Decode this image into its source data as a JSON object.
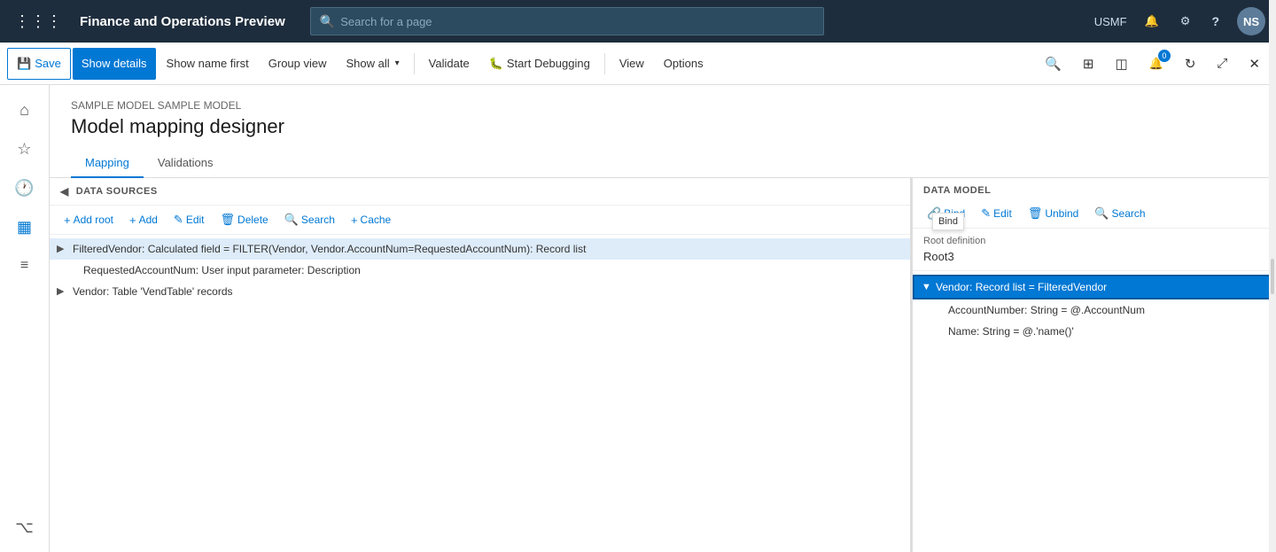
{
  "app": {
    "title": "Finance and Operations Preview",
    "env": "USMF"
  },
  "searchbar": {
    "placeholder": "Search for a page"
  },
  "toolbar": {
    "save": "Save",
    "show_details": "Show details",
    "show_name_first": "Show name first",
    "group_view": "Group view",
    "show_all": "Show all",
    "validate": "Validate",
    "start_debugging": "Start Debugging",
    "view": "View",
    "options": "Options"
  },
  "breadcrumb": "SAMPLE MODEL SAMPLE MODEL",
  "page_title": "Model mapping designer",
  "tabs": [
    {
      "label": "Mapping",
      "active": true
    },
    {
      "label": "Validations",
      "active": false
    }
  ],
  "datasources_panel": {
    "header": "DATA SOURCES",
    "buttons": [
      {
        "icon": "+",
        "label": "Add root"
      },
      {
        "icon": "+",
        "label": "Add"
      },
      {
        "icon": "✎",
        "label": "Edit"
      },
      {
        "icon": "🗑",
        "label": "Delete"
      },
      {
        "icon": "🔍",
        "label": "Search"
      },
      {
        "icon": "+",
        "label": "Cache"
      }
    ],
    "items": [
      {
        "indent": 0,
        "toggle": "▶",
        "text": "FilteredVendor: Calculated field = FILTER(Vendor, Vendor.AccountNum=RequestedAccountNum): Record list",
        "selected": true
      },
      {
        "indent": 1,
        "toggle": "",
        "text": "RequestedAccountNum: User input parameter: Description",
        "selected": false
      },
      {
        "indent": 0,
        "toggle": "▶",
        "text": "Vendor: Table 'VendTable' records",
        "selected": false
      }
    ]
  },
  "datamodel_panel": {
    "header": "DATA MODEL",
    "buttons": [
      {
        "icon": "🔗",
        "label": "Bind"
      },
      {
        "icon": "✎",
        "label": "Edit"
      },
      {
        "icon": "🗑",
        "label": "Unbind"
      },
      {
        "icon": "🔍",
        "label": "Search"
      }
    ],
    "root_definition_label": "Root definition",
    "root_definition_value": "Root3",
    "items": [
      {
        "indent": 0,
        "toggle": "▼",
        "text": "Vendor: Record list = FilteredVendor",
        "selected": true
      },
      {
        "indent": 1,
        "toggle": "",
        "text": "AccountNumber: String = @.AccountNum",
        "selected": false
      },
      {
        "indent": 1,
        "toggle": "",
        "text": "Name: String = @.'name()'",
        "selected": false
      }
    ]
  },
  "sidebar_icons": [
    {
      "name": "home-icon",
      "glyph": "⌂"
    },
    {
      "name": "star-icon",
      "glyph": "☆"
    },
    {
      "name": "clock-icon",
      "glyph": "🕐"
    },
    {
      "name": "grid-icon",
      "glyph": "▦"
    },
    {
      "name": "list-icon",
      "glyph": "≡"
    }
  ],
  "topnav_icons": {
    "notification": "🔔",
    "settings": "⚙",
    "help": "?",
    "avatar_initials": "NS"
  }
}
